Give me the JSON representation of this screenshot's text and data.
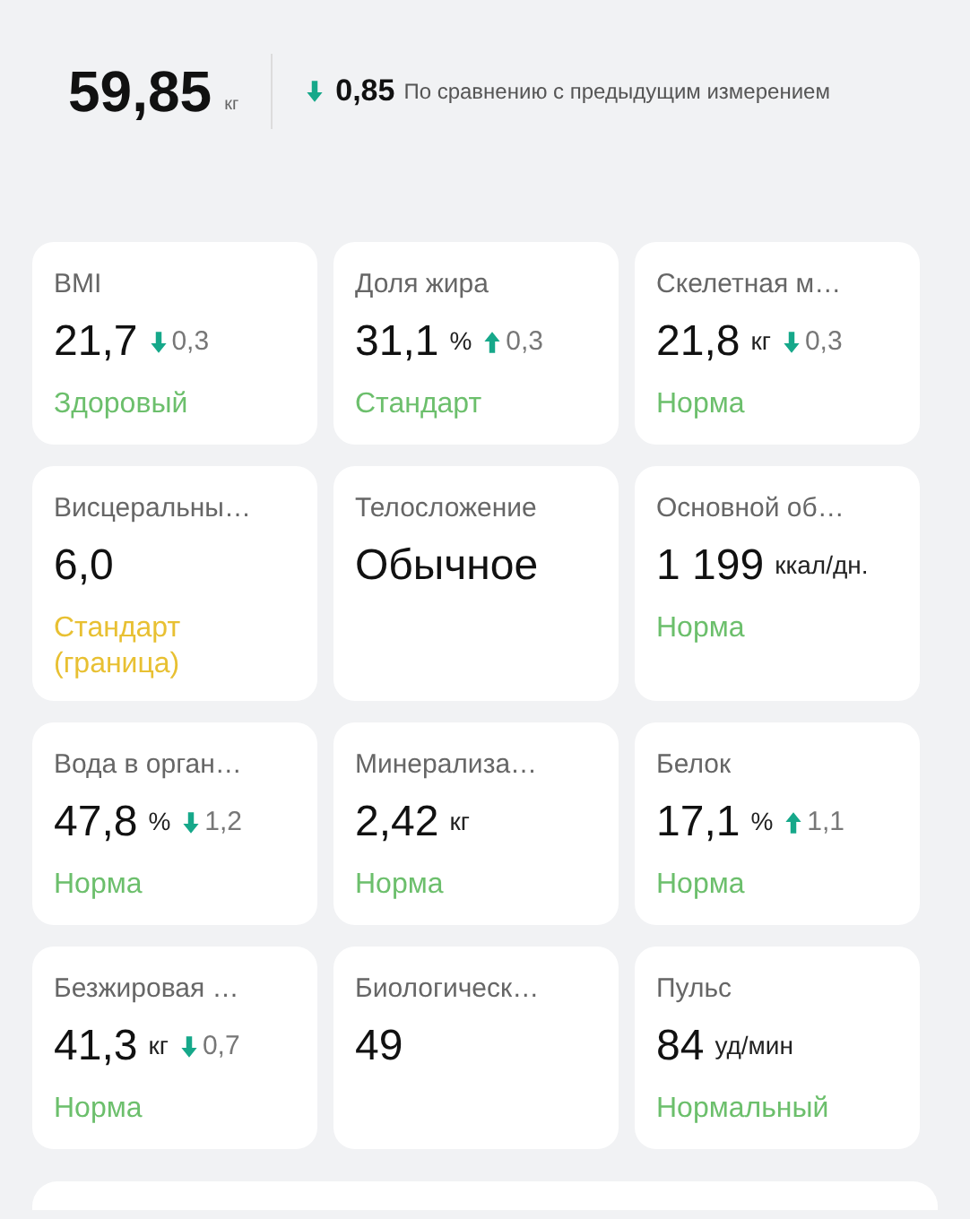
{
  "summary": {
    "weight": "59,85",
    "unit": "кг",
    "increased": false,
    "change": "0,85",
    "caption": "По сравнению с предыдущим измерением"
  },
  "metrics": [
    {
      "title": "BMI",
      "value": "21,7",
      "increased": false,
      "change": "0,3",
      "status": "Здоровый",
      "color": "#6cbf6c"
    },
    {
      "title": "Доля жира",
      "value": "31,1",
      "unit": "%",
      "increased": true,
      "change": "0,3",
      "status": "Стандарт",
      "color": "#6cbf6c"
    },
    {
      "title": "Скелетная м…",
      "value": "21,8",
      "unit": "кг",
      "increased": false,
      "change": "0,3",
      "status": "Норма",
      "color": "#6cbf6c"
    },
    {
      "title": "Висцеральны…",
      "value": "6,0",
      "status": "Стандарт (граница)",
      "color": "#e8c032"
    },
    {
      "title": "Телосложение",
      "value": "Обычное"
    },
    {
      "title": "Основной об…",
      "value": "1 199",
      "unit": "ккал/дн.",
      "status": "Норма",
      "color": "#6cbf6c"
    },
    {
      "title": "Вода в орган…",
      "value": "47,8",
      "unit": "%",
      "increased": false,
      "change": "1,2",
      "status": "Норма",
      "color": "#6cbf6c"
    },
    {
      "title": "Минерализа…",
      "value": "2,42",
      "unit": "кг",
      "status": "Норма",
      "color": "#6cbf6c"
    },
    {
      "title": "Белок",
      "value": "17,1",
      "unit": "%",
      "increased": true,
      "change": "1,1",
      "status": "Норма",
      "color": "#6cbf6c"
    },
    {
      "title": "Безжировая …",
      "value": "41,3",
      "unit": "кг",
      "increased": false,
      "change": "0,7",
      "status": "Норма",
      "color": "#6cbf6c"
    },
    {
      "title": "Биологическ…",
      "value": "49"
    },
    {
      "title": "Пульс",
      "value": "84",
      "unit": "уд/мин",
      "status": "Нормальный",
      "color": "#6cbf6c"
    }
  ]
}
